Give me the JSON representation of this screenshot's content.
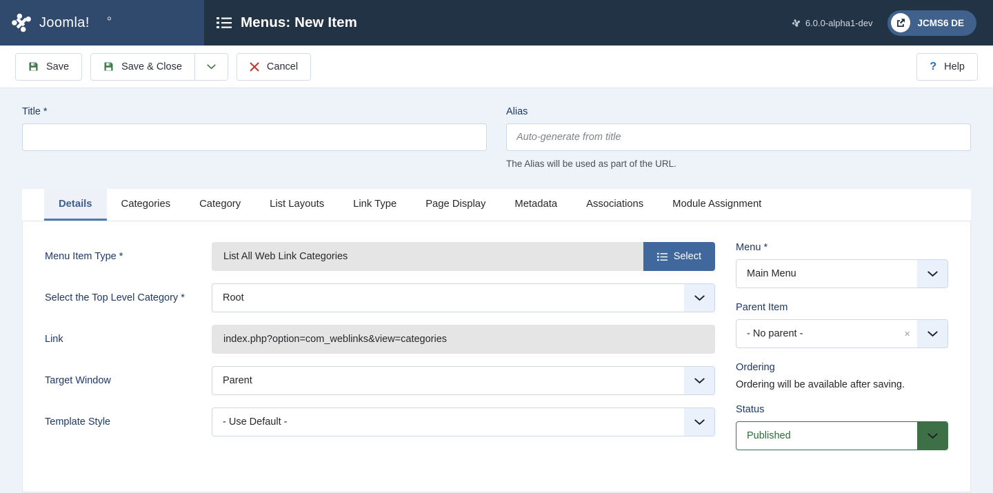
{
  "header": {
    "brand": "Joomla!",
    "page_title": "Menus: New Item",
    "version": "6.0.0-alpha1-dev",
    "site_name": "JCMS6 DE"
  },
  "toolbar": {
    "save_label": "Save",
    "save_close_label": "Save & Close",
    "cancel_label": "Cancel",
    "help_label": "Help",
    "help_symbol": "?"
  },
  "form": {
    "title_label": "Title *",
    "title_value": "",
    "title_placeholder": "",
    "alias_label": "Alias",
    "alias_value": "",
    "alias_placeholder": "Auto-generate from title",
    "alias_help": "The Alias will be used as part of the URL."
  },
  "tabs": [
    {
      "label": "Details",
      "active": true
    },
    {
      "label": "Categories",
      "active": false
    },
    {
      "label": "Category",
      "active": false
    },
    {
      "label": "List Layouts",
      "active": false
    },
    {
      "label": "Link Type",
      "active": false
    },
    {
      "label": "Page Display",
      "active": false
    },
    {
      "label": "Metadata",
      "active": false
    },
    {
      "label": "Associations",
      "active": false
    },
    {
      "label": "Module Assignment",
      "active": false
    }
  ],
  "details": {
    "menu_item_type_label": "Menu Item Type *",
    "menu_item_type_value": "List All Web Link Categories",
    "select_button_label": "Select",
    "top_level_category_label": "Select the Top Level Category *",
    "top_level_category_value": "Root",
    "link_label": "Link",
    "link_value": "index.php?option=com_weblinks&view=categories",
    "target_window_label": "Target Window",
    "target_window_value": "Parent",
    "template_style_label": "Template Style",
    "template_style_value": "- Use Default -"
  },
  "sidebar": {
    "menu_label": "Menu *",
    "menu_value": "Main Menu",
    "parent_item_label": "Parent Item",
    "parent_item_value": "- No parent -",
    "parent_clear_symbol": "×",
    "ordering_label": "Ordering",
    "ordering_note": "Ordering will be available after saving.",
    "status_label": "Status",
    "status_value": "Published"
  },
  "colors": {
    "header_left": "#2f4a6d",
    "header_right": "#233346",
    "accent_blue": "#41689c",
    "status_green": "#3e7048",
    "page_bg": "#eef2f9",
    "save_icon_green": "#3d7a4a",
    "cancel_red": "#c0392b",
    "help_blue": "#2a6ebb"
  }
}
